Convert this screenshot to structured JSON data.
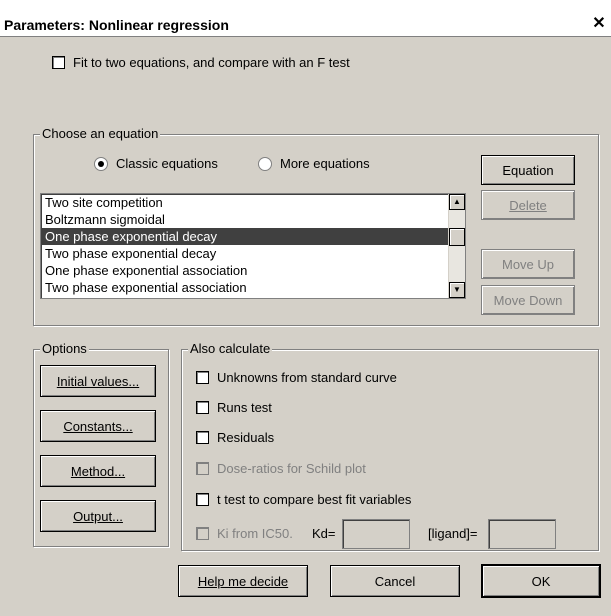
{
  "window": {
    "title": "Parameters: Nonlinear regression",
    "close_glyph": "✕"
  },
  "top_option": {
    "label": "Fit to two equations, and compare with an F test",
    "checked": false
  },
  "choose_equation": {
    "legend": "Choose an equation",
    "radio_classic": "Classic equations",
    "radio_more": "More equations",
    "selected_radio": "classic",
    "equations": [
      "Two site competition",
      "Boltzmann sigmoidal",
      "One phase exponential decay",
      "Two phase exponential decay",
      "One phase exponential association",
      "Two phase exponential association"
    ],
    "selected_equation": "One phase exponential decay",
    "buttons": {
      "equation": "Equation",
      "delete": "Delete",
      "move_up": "Move Up",
      "move_down": "Move Down"
    }
  },
  "options": {
    "legend": "Options",
    "initial_values": "Initial values...",
    "constants": "Constants...",
    "method": "Method...",
    "output": "Output..."
  },
  "also_calculate": {
    "legend": "Also calculate",
    "unknowns": "Unknowns from standard curve",
    "runs_test": "Runs test",
    "residuals": "Residuals",
    "dose_ratios": "Dose-ratios for Schild plot",
    "t_test": "t test to compare best fit variables",
    "ki": "Ki from IC50.",
    "kd_label": "Kd=",
    "ligand_label": "[ligand]=",
    "kd_value": "",
    "ligand_value": ""
  },
  "footer": {
    "help": "Help me decide",
    "cancel": "Cancel",
    "ok": "OK"
  }
}
